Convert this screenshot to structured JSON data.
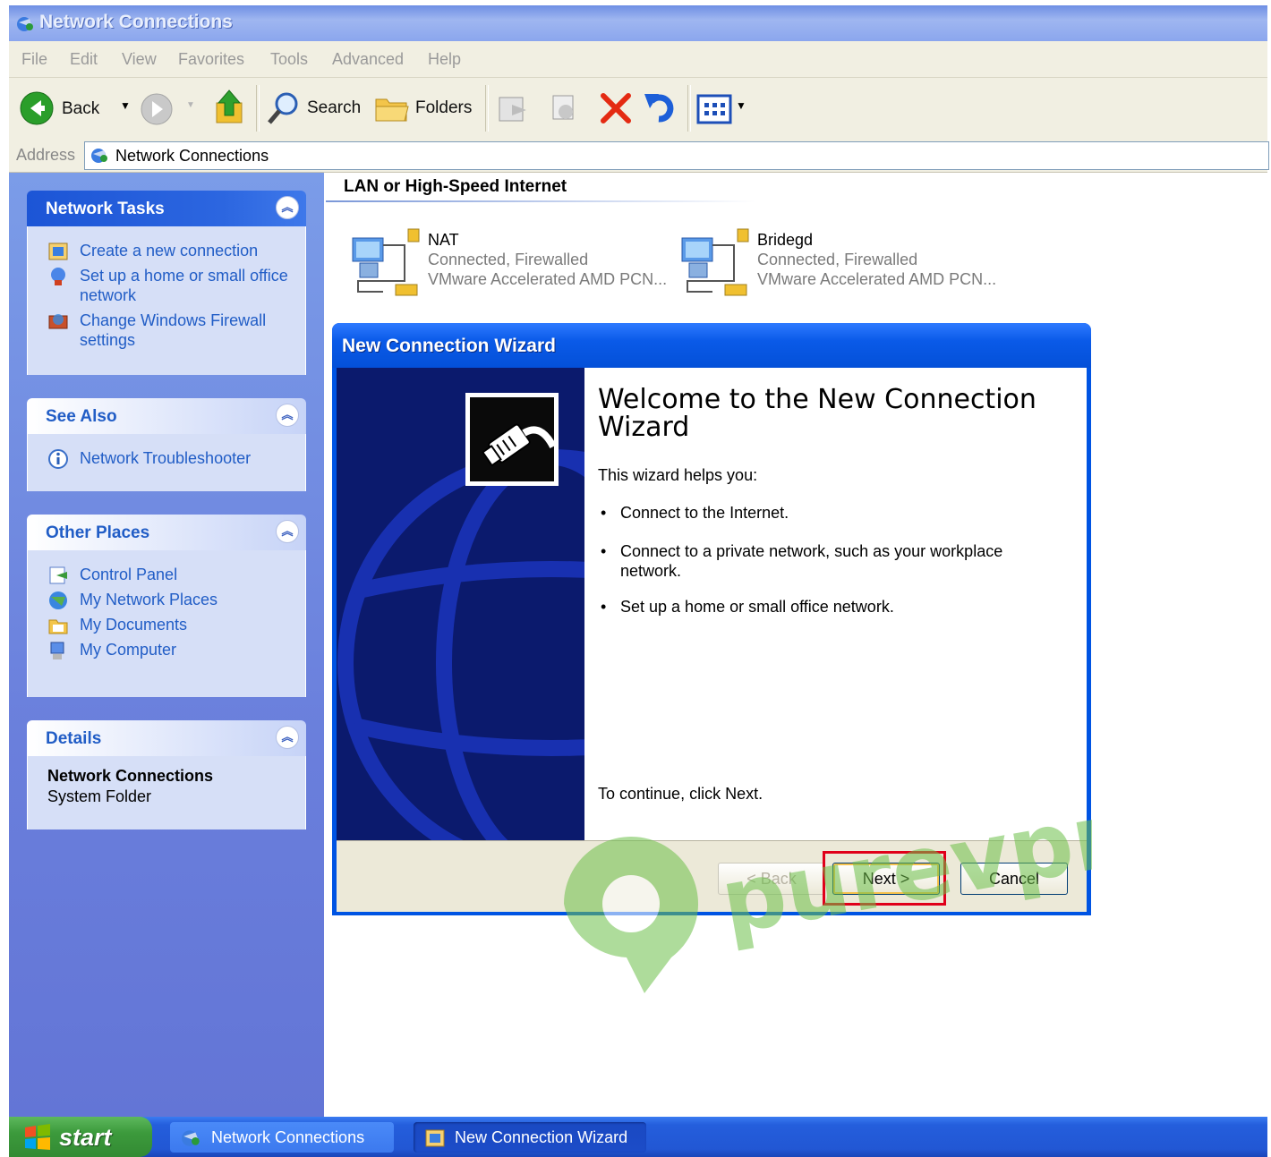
{
  "window": {
    "title": "Network Connections"
  },
  "menu": [
    "File",
    "Edit",
    "View",
    "Favorites",
    "Tools",
    "Advanced",
    "Help"
  ],
  "toolbar": {
    "back_label": "Back",
    "search_label": "Search",
    "folders_label": "Folders"
  },
  "address": {
    "label": "Address",
    "value": "Network Connections"
  },
  "left_panel": {
    "network_tasks": {
      "title": "Network Tasks",
      "items": [
        "Create a new connection",
        "Set up a home or small office network",
        "Change Windows Firewall settings"
      ]
    },
    "see_also": {
      "title": "See Also",
      "items": [
        "Network Troubleshooter"
      ]
    },
    "other_places": {
      "title": "Other Places",
      "items": [
        "Control Panel",
        "My Network Places",
        "My Documents",
        "My Computer"
      ]
    },
    "details": {
      "title": "Details",
      "name": "Network Connections",
      "type": "System Folder"
    }
  },
  "content": {
    "group_title": "LAN or High-Speed Internet",
    "connections": [
      {
        "name": "NAT",
        "status": "Connected, Firewalled",
        "device": "VMware Accelerated AMD PCN..."
      },
      {
        "name": "Bridegd",
        "status": "Connected, Firewalled",
        "device": "VMware Accelerated AMD PCN..."
      }
    ]
  },
  "wizard": {
    "title": "New Connection Wizard",
    "heading": "Welcome to the New Connection Wizard",
    "intro": "This wizard helps you:",
    "bullets": [
      "Connect to the Internet.",
      "Connect to a private network, such as your workplace network.",
      "Set up a home or small office network."
    ],
    "continue_text": "To continue, click Next.",
    "buttons": {
      "back": "< Back",
      "next": "Next >",
      "cancel": "Cancel"
    }
  },
  "taskbar": {
    "start_label": "start",
    "tasks": [
      "Network Connections",
      "New Connection Wizard"
    ]
  },
  "watermark": {
    "text": "purevpn"
  },
  "colors": {
    "xp_blue": "#0054e3",
    "link_blue": "#215dc6",
    "highlight_red": "#e0001a"
  }
}
